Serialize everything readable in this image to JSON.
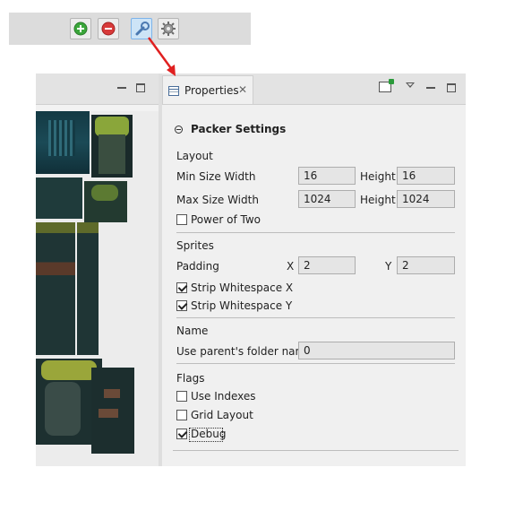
{
  "toolbar": {
    "buttons": [
      {
        "icon": "add-icon",
        "color": "#3aa63a"
      },
      {
        "icon": "remove-icon",
        "color": "#d83a3a"
      },
      {
        "icon": "wrench-icon",
        "color": "#4a78b0"
      },
      {
        "icon": "gear-icon",
        "color": "#8a8a8a"
      }
    ]
  },
  "properties": {
    "tab_label": "Properties",
    "close_glyph": "✕",
    "section_title": "Packer Settings",
    "layout": {
      "heading": "Layout",
      "min_size_label": "Min Size  Width",
      "min_width": "16",
      "min_height_label": "Height",
      "min_height": "16",
      "max_size_label": "Max Size  Width",
      "max_width": "1024",
      "max_height_label": "Height",
      "max_height": "1024",
      "power_of_two_label": "Power of Two",
      "power_of_two": false
    },
    "sprites": {
      "heading": "Sprites",
      "padding_label": "Padding",
      "x_label": "X",
      "padding_x": "2",
      "y_label": "Y",
      "padding_y": "2",
      "strip_x_label": "Strip Whitespace X",
      "strip_x": true,
      "strip_y_label": "Strip Whitespace Y",
      "strip_y": true
    },
    "name": {
      "heading": "Name",
      "use_parent_label": "Use parent's folder name",
      "use_parent_value": "0"
    },
    "flags": {
      "heading": "Flags",
      "use_indexes_label": "Use Indexes",
      "use_indexes": false,
      "grid_layout_label": "Grid Layout",
      "grid_layout": false,
      "debug_label": "Debug",
      "debug": true
    }
  },
  "colors": {
    "arrow": "#e02020",
    "active_button": "#cde4f7"
  }
}
